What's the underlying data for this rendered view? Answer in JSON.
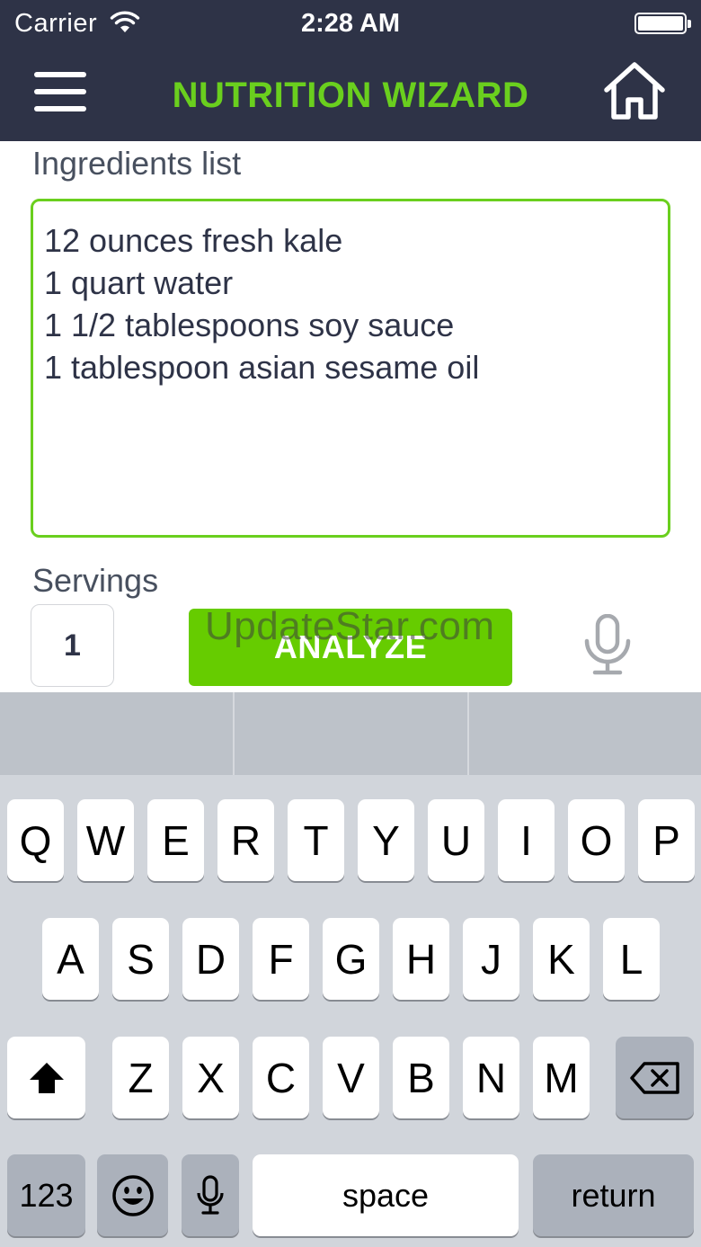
{
  "status_bar": {
    "carrier": "Carrier",
    "time": "2:28 AM"
  },
  "nav": {
    "title": "NUTRITION WIZARD"
  },
  "ingredients": {
    "label": "Ingredients list",
    "lines": [
      "12 ounces fresh kale",
      "1 quart water",
      "1 1/2 tablespoons soy sauce",
      "1 tablespoon asian sesame oil"
    ]
  },
  "servings": {
    "label": "Servings",
    "value": "1"
  },
  "analyze": {
    "label": "ANALYZE"
  },
  "watermark": "UpdateStar.com",
  "keyboard": {
    "row1": [
      "Q",
      "W",
      "E",
      "R",
      "T",
      "Y",
      "U",
      "I",
      "O",
      "P"
    ],
    "row2": [
      "A",
      "S",
      "D",
      "F",
      "G",
      "H",
      "J",
      "K",
      "L"
    ],
    "row3": [
      "Z",
      "X",
      "C",
      "V",
      "B",
      "N",
      "M"
    ],
    "numbers_label": "123",
    "space_label": "space",
    "return_label": "return"
  },
  "colors": {
    "navbar": "#2e3347",
    "accent": "#6acf1e",
    "button": "#66cc00"
  },
  "icons": [
    "wifi-icon",
    "battery-icon",
    "hamburger-menu-icon",
    "home-icon",
    "microphone-icon",
    "shift-icon",
    "backspace-icon",
    "emoji-icon"
  ]
}
